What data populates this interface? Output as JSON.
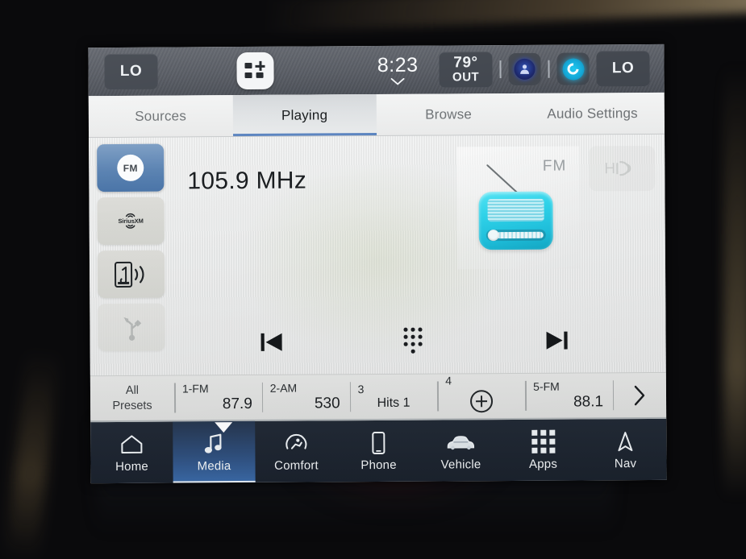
{
  "status_bar": {
    "climate_left": "LO",
    "climate_right": "LO",
    "clock": "8:23",
    "temperature": "79°",
    "temperature_unit_label": "OUT",
    "widget_icon": "add-widget-icon",
    "chevron_icon": "chevron-down-icon",
    "assistant_icon": "voice-assistant-icon",
    "alexa_icon": "alexa-icon"
  },
  "tabs": [
    {
      "label": "Sources",
      "active": false
    },
    {
      "label": "Playing",
      "active": true
    },
    {
      "label": "Browse",
      "active": false
    },
    {
      "label": "Audio Settings",
      "active": false
    }
  ],
  "sources": [
    {
      "name": "FM",
      "label": "FM",
      "icon": "fm-radio-icon",
      "active": true,
      "dim": false
    },
    {
      "name": "SiriusXM",
      "label": "SiriusXM",
      "icon": "siriusxm-icon",
      "active": false,
      "dim": false
    },
    {
      "name": "Bluetooth Audio",
      "label": "",
      "icon": "bluetooth-audio-icon",
      "active": false,
      "dim": false
    },
    {
      "name": "USB",
      "label": "",
      "icon": "usb-icon",
      "active": false,
      "dim": true
    }
  ],
  "now_playing": {
    "frequency": "105.9 MHz",
    "band": "FM",
    "artwork_icon": "retro-radio-icon",
    "hd_radio_label": "HD",
    "hd_radio_enabled": false
  },
  "transport": {
    "previous_icon": "skip-previous-icon",
    "keypad_icon": "direct-tune-keypad-icon",
    "next_icon": "skip-next-icon"
  },
  "presets": {
    "all_presets_line1": "All",
    "all_presets_line2": "Presets",
    "items": [
      {
        "number": "1-FM",
        "value": "87.9",
        "empty": false,
        "is_text": false
      },
      {
        "number": "2-AM",
        "value": "530",
        "empty": false,
        "is_text": false
      },
      {
        "number": "3",
        "value": "Hits 1",
        "empty": false,
        "is_text": true
      },
      {
        "number": "4",
        "value": "",
        "empty": true,
        "is_text": false
      },
      {
        "number": "5-FM",
        "value": "88.1",
        "empty": false,
        "is_text": false
      }
    ],
    "next_page_icon": "chevron-right-icon"
  },
  "nav": [
    {
      "label": "Home",
      "icon": "home-icon",
      "active": false
    },
    {
      "label": "Media",
      "icon": "music-note-icon",
      "active": true
    },
    {
      "label": "Comfort",
      "icon": "climate-seat-icon",
      "active": false
    },
    {
      "label": "Phone",
      "icon": "phone-icon",
      "active": false
    },
    {
      "label": "Vehicle",
      "icon": "car-icon",
      "active": false
    },
    {
      "label": "Apps",
      "icon": "apps-grid-icon",
      "active": false
    },
    {
      "label": "Nav",
      "icon": "navigation-arrow-icon",
      "active": false
    }
  ],
  "colors": {
    "accent_blue": "#3b6aa8",
    "tab_underline": "#5b84bf",
    "radio_cyan": "#2fd3ea",
    "status_bar": "#52565e",
    "nav_bar": "#1b222d"
  }
}
